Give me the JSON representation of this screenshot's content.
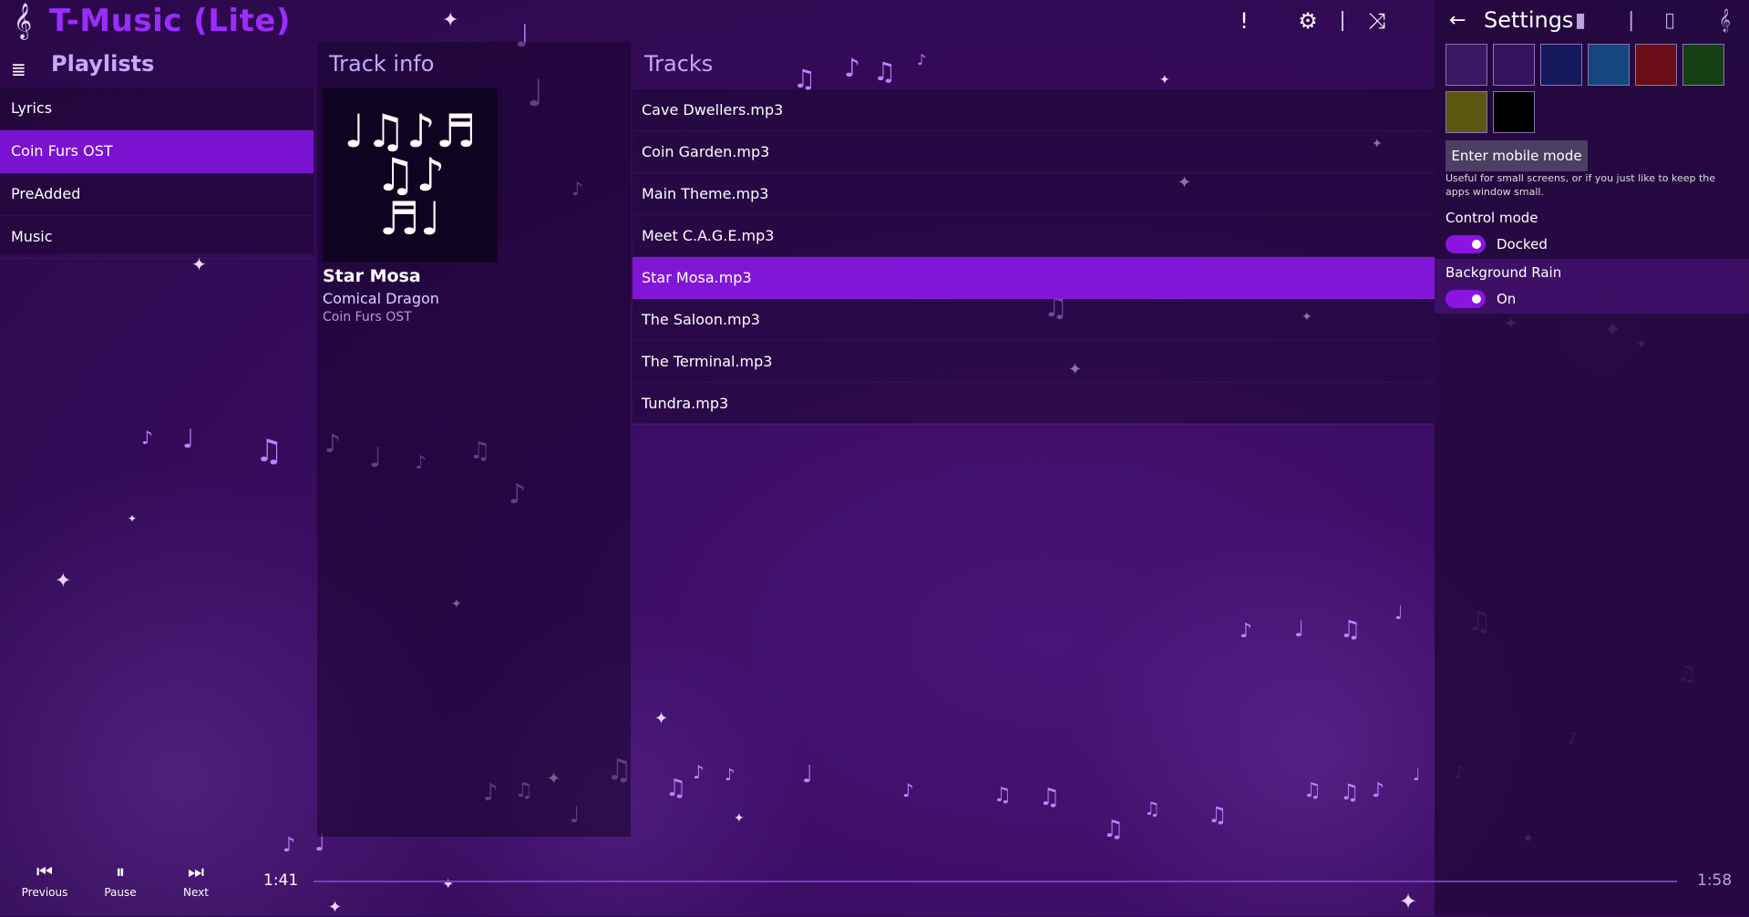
{
  "app": {
    "title": "T-Music (Lite)"
  },
  "headers": {
    "playlists": "Playlists",
    "track_info": "Track info",
    "tracks": "Tracks"
  },
  "playlists": [
    {
      "label": "Lyrics",
      "active": false
    },
    {
      "label": "Coin Furs OST",
      "active": true
    },
    {
      "label": "PreAdded",
      "active": false
    },
    {
      "label": "Music",
      "active": false
    }
  ],
  "track_info": {
    "title": "Star Mosa",
    "artist": "Comical Dragon",
    "album": "Coin Furs OST"
  },
  "tracks": [
    {
      "label": "Cave Dwellers.mp3",
      "active": false
    },
    {
      "label": "Coin Garden.mp3",
      "active": false
    },
    {
      "label": "Main Theme.mp3",
      "active": false
    },
    {
      "label": "Meet C.A.G.E.mp3",
      "active": false
    },
    {
      "label": "Star Mosa.mp3",
      "active": true
    },
    {
      "label": "The Saloon.mp3",
      "active": false
    },
    {
      "label": "The Terminal.mp3",
      "active": false
    },
    {
      "label": "Tundra.mp3",
      "active": false
    }
  ],
  "settings": {
    "title": "Settings",
    "swatches": [
      {
        "color": "#3a1862"
      },
      {
        "color": "#35145e"
      },
      {
        "color": "#16185c"
      },
      {
        "color": "#15467d"
      },
      {
        "color": "#6b0d16"
      },
      {
        "color": "#143f12"
      },
      {
        "color": "#5a5810"
      },
      {
        "color": "#000000"
      }
    ],
    "mobile_button": "Enter mobile mode",
    "mobile_hint": "Useful for small screens, or if you just like to keep the apps window small.",
    "control_mode": {
      "label": "Control mode",
      "value": "Docked",
      "on": true
    },
    "background_rain": {
      "label": "Background Rain",
      "value": "On",
      "on": true
    }
  },
  "player": {
    "previous": "Previous",
    "pause": "Pause",
    "next": "Next",
    "elapsed": "1:41",
    "duration": "1:58",
    "progress_fraction": 0.0
  },
  "icons": {
    "alert": "!",
    "gear": "⚙",
    "shuffle": "⤨",
    "back": "←",
    "hamburger": "≣",
    "prev": "⏮",
    "pause": "⏸",
    "next": "⏭"
  },
  "colors": {
    "accent": "#8216d8",
    "title": "#9c2bff",
    "header": "#c6a8ff"
  }
}
